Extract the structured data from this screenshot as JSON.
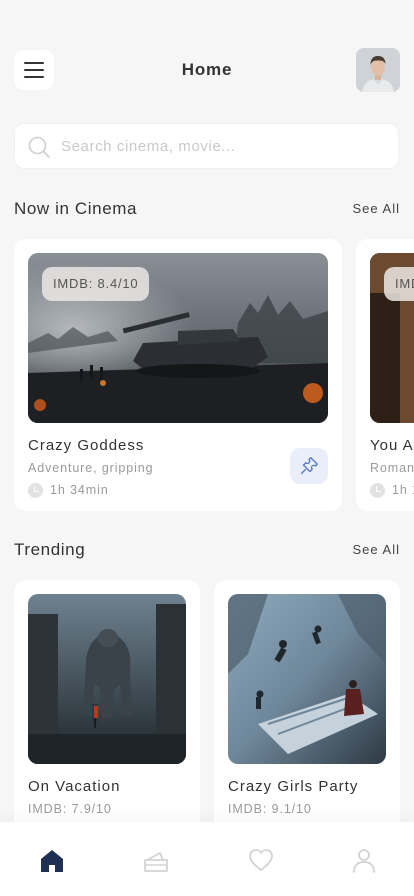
{
  "header": {
    "title": "Home",
    "menu_icon": "hamburger-menu-icon",
    "avatar_icon": "user-avatar"
  },
  "search": {
    "placeholder": "Search cinema, movie...",
    "value": "",
    "icon": "search-icon"
  },
  "now_in_cinema": {
    "section_title": "Now in Cinema",
    "see_all_label": "See All",
    "cards": [
      {
        "title": "Crazy Goddess",
        "rating": "IMDB: 8.4/10",
        "genre": "Adventure, gripping",
        "duration": "1h 34min",
        "action_icon": "ticket-icon"
      },
      {
        "title": "You A",
        "rating": "IMD",
        "genre": "Roman",
        "duration": "1h 1"
      }
    ]
  },
  "trending": {
    "section_title": "Trending",
    "see_all_label": "See All",
    "cards": [
      {
        "title": "On Vacation",
        "rating": "IMDB: 7.9/10"
      },
      {
        "title": "Crazy Girls Party",
        "rating": "IMDB: 9.1/10"
      }
    ]
  },
  "bottom_nav": {
    "items": [
      {
        "icon": "home-icon",
        "active": true
      },
      {
        "icon": "ticket-icon",
        "active": false
      },
      {
        "icon": "heart-icon",
        "active": false
      },
      {
        "icon": "profile-icon",
        "active": false
      }
    ],
    "active_color": "#1f2f52",
    "inactive_color": "#d3d3d3"
  },
  "colors": {
    "background": "#f6f6f6",
    "card": "#ffffff",
    "accent_blue": "#5b7bc4",
    "ticket_bg": "#e9eef8"
  }
}
